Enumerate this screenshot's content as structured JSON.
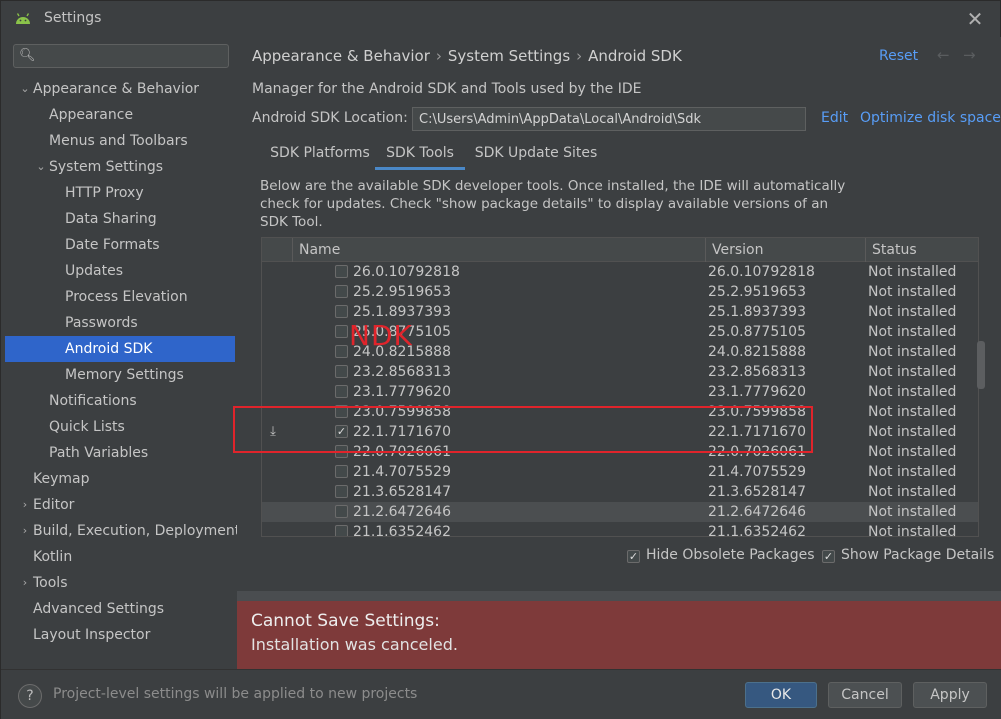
{
  "window": {
    "title": "Settings"
  },
  "sidebar": {
    "search_placeholder": "",
    "items": [
      {
        "label": "Appearance & Behavior",
        "arrow": "⌄"
      },
      {
        "label": "Appearance"
      },
      {
        "label": "Menus and Toolbars"
      },
      {
        "label": "System Settings",
        "arrow": "⌄"
      },
      {
        "label": "HTTP Proxy"
      },
      {
        "label": "Data Sharing"
      },
      {
        "label": "Date Formats"
      },
      {
        "label": "Updates"
      },
      {
        "label": "Process Elevation"
      },
      {
        "label": "Passwords"
      },
      {
        "label": "Android SDK"
      },
      {
        "label": "Memory Settings"
      },
      {
        "label": "Notifications"
      },
      {
        "label": "Quick Lists"
      },
      {
        "label": "Path Variables"
      },
      {
        "label": "Keymap"
      },
      {
        "label": "Editor",
        "arrow": "›"
      },
      {
        "label": "Build, Execution, Deployment",
        "arrow": "›"
      },
      {
        "label": "Kotlin"
      },
      {
        "label": "Tools",
        "arrow": "›"
      },
      {
        "label": "Advanced Settings"
      },
      {
        "label": "Layout Inspector"
      }
    ]
  },
  "main": {
    "breadcrumb": [
      "Appearance & Behavior",
      "System Settings",
      "Android SDK"
    ],
    "reset_label": "Reset",
    "description": "Manager for the Android SDK and Tools used by the IDE",
    "sdk_location_label": "Android SDK Location:",
    "sdk_location_value": "C:\\Users\\Admin\\AppData\\Local\\Android\\Sdk",
    "edit_label": "Edit",
    "optimize_label": "Optimize disk space",
    "tabs": [
      "SDK Platforms",
      "SDK Tools",
      "SDK Update Sites"
    ],
    "tools_description": "Below are the available SDK developer tools. Once installed, the IDE will automatically check for updates. Check \"show package details\" to display available versions of an SDK Tool.",
    "table": {
      "headers": [
        "Name",
        "Version",
        "Status"
      ],
      "rows": [
        {
          "name": "26.0.10792818",
          "version": "26.0.10792818",
          "status": "Not installed",
          "checked": ""
        },
        {
          "name": "25.2.9519653",
          "version": "25.2.9519653",
          "status": "Not installed",
          "checked": ""
        },
        {
          "name": "25.1.8937393",
          "version": "25.1.8937393",
          "status": "Not installed",
          "checked": ""
        },
        {
          "name": "25.0.8775105",
          "version": "25.0.8775105",
          "status": "Not installed",
          "checked": ""
        },
        {
          "name": "24.0.8215888",
          "version": "24.0.8215888",
          "status": "Not installed",
          "checked": ""
        },
        {
          "name": "23.2.8568313",
          "version": "23.2.8568313",
          "status": "Not installed",
          "checked": ""
        },
        {
          "name": "23.1.7779620",
          "version": "23.1.7779620",
          "status": "Not installed",
          "checked": ""
        },
        {
          "name": "23.0.7599858",
          "version": "23.0.7599858",
          "status": "Not installed",
          "checked": ""
        },
        {
          "name": "22.1.7171670",
          "version": "22.1.7171670",
          "status": "Not installed",
          "checked": "✓",
          "download": "⤓"
        },
        {
          "name": "22.0.7026061",
          "version": "22.0.7026061",
          "status": "Not installed",
          "checked": ""
        },
        {
          "name": "21.4.7075529",
          "version": "21.4.7075529",
          "status": "Not installed",
          "checked": ""
        },
        {
          "name": "21.3.6528147",
          "version": "21.3.6528147",
          "status": "Not installed",
          "checked": ""
        },
        {
          "name": "21.2.6472646",
          "version": "21.2.6472646",
          "status": "Not installed",
          "checked": ""
        },
        {
          "name": "21.1.6352462",
          "version": "21.1.6352462",
          "status": "Not installed",
          "checked": ""
        }
      ]
    },
    "annotation": "NDK",
    "hide_obsolete_label": "Hide Obsolete Packages",
    "show_details_label": "Show Package Details",
    "error_title": "Cannot Save Settings:",
    "error_message": "Installation was canceled."
  },
  "footer": {
    "note": "Project-level settings will be applied to new projects",
    "ok_label": "OK",
    "cancel_label": "Cancel",
    "apply_label": "Apply"
  },
  "colors": {
    "background": "#3c3f41",
    "selection": "#2f65ca",
    "link": "#589df6",
    "error_panel": "#7e3a3a",
    "annotation": "#e0242b"
  }
}
